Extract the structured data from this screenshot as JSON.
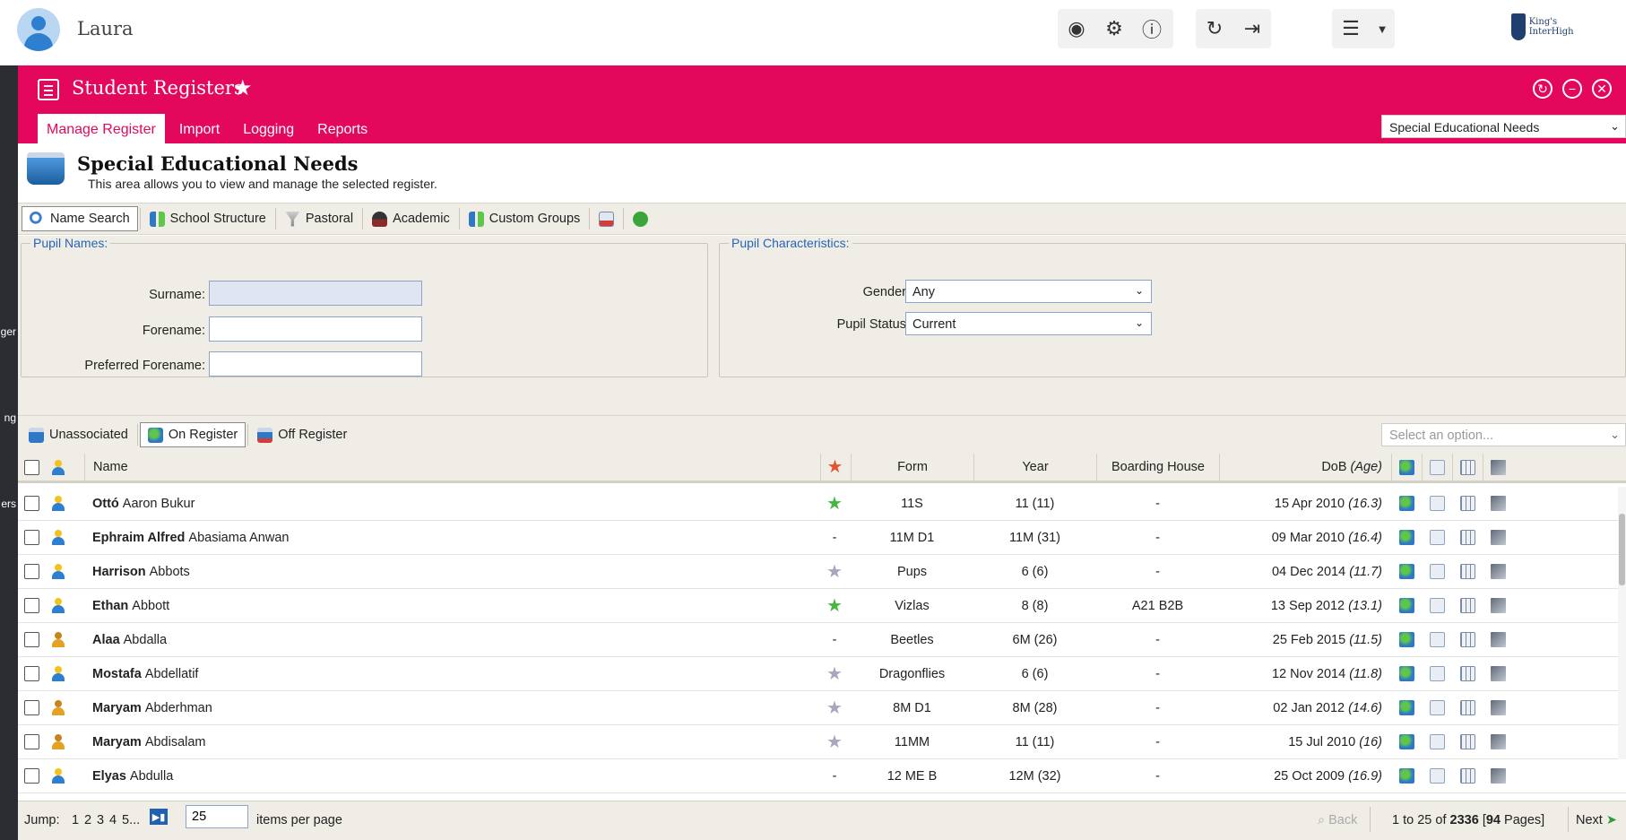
{
  "topbar": {
    "user_name": "Laura",
    "logo_text": "King's InterHigh"
  },
  "sidebar_fragments": [
    "ger",
    "ng",
    "ers"
  ],
  "module": {
    "title": "Student Registers",
    "tabs": [
      "Manage Register",
      "Import",
      "Logging",
      "Reports"
    ],
    "register_select": "Special Educational Needs"
  },
  "page": {
    "title": "Special Educational Needs",
    "description": "This area allows you to view and manage the selected register."
  },
  "toolbar": [
    "Name Search",
    "School Structure",
    "Pastoral",
    "Academic",
    "Custom Groups"
  ],
  "pupil_names": {
    "legend": "Pupil Names:",
    "surname_label": "Surname:",
    "forename_label": "Forename:",
    "preferred_label": "Preferred Forename:",
    "surname_value": "",
    "forename_value": "",
    "preferred_value": ""
  },
  "pupil_characteristics": {
    "legend": "Pupil Characteristics:",
    "gender_label": "Gender:",
    "gender_value": "Any",
    "status_label": "Pupil Status:",
    "status_value": "Current"
  },
  "register_filter": {
    "buttons": [
      "Unassociated",
      "On Register",
      "Off Register"
    ],
    "active": "On Register",
    "option_placeholder": "Select an option..."
  },
  "grid": {
    "columns": {
      "name": "Name",
      "form": "Form",
      "year": "Year",
      "boarding": "Boarding House",
      "dob": "DoB",
      "age": "(Age)"
    },
    "rows": [
      {
        "first": "Ottó",
        "last": "Aaron Bukur",
        "gender": "m",
        "star": "green",
        "form": "11S",
        "year": "11 (11)",
        "boarding": "-",
        "dob": "15 Apr 2010",
        "age": "(16.3)"
      },
      {
        "first": "Ephraim Alfred",
        "last": "Abasiama Anwan",
        "gender": "m",
        "star": "-",
        "form": "11M D1",
        "year": "11M (31)",
        "boarding": "-",
        "dob": "09 Mar 2010",
        "age": "(16.4)"
      },
      {
        "first": "Harrison",
        "last": "Abbots",
        "gender": "m",
        "star": "grey",
        "form": "Pups",
        "year": "6 (6)",
        "boarding": "-",
        "dob": "04 Dec 2014",
        "age": "(11.7)"
      },
      {
        "first": "Ethan",
        "last": "Abbott",
        "gender": "m",
        "star": "green",
        "form": "Vizlas",
        "year": "8 (8)",
        "boarding": "A21 B2B",
        "dob": "13 Sep 2012",
        "age": "(13.1)"
      },
      {
        "first": "Alaa",
        "last": "Abdalla",
        "gender": "f",
        "star": "-",
        "form": "Beetles",
        "year": "6M (26)",
        "boarding": "-",
        "dob": "25 Feb 2015",
        "age": "(11.5)"
      },
      {
        "first": "Mostafa",
        "last": "Abdellatif",
        "gender": "m",
        "star": "grey",
        "form": "Dragonflies",
        "year": "6 (6)",
        "boarding": "-",
        "dob": "12 Nov 2014",
        "age": "(11.8)"
      },
      {
        "first": "Maryam",
        "last": "Abderhman",
        "gender": "f",
        "star": "grey",
        "form": "8M D1",
        "year": "8M (28)",
        "boarding": "-",
        "dob": "02 Jan 2012",
        "age": "(14.6)"
      },
      {
        "first": "Maryam",
        "last": "Abdisalam",
        "gender": "f",
        "star": "grey",
        "form": "11MM",
        "year": "11 (11)",
        "boarding": "-",
        "dob": "15 Jul 2010",
        "age": "(16)"
      },
      {
        "first": "Elyas",
        "last": "Abdulla",
        "gender": "m",
        "star": "-",
        "form": "12 ME B",
        "year": "12M (32)",
        "boarding": "-",
        "dob": "25 Oct 2009",
        "age": "(16.9)"
      }
    ]
  },
  "pager": {
    "jump_label": "Jump:",
    "pages": [
      "1",
      "2",
      "3",
      "4",
      "5..."
    ],
    "items_per_page": "25",
    "items_per_page_label": "items per page",
    "back_label": "Back",
    "range_from": "1",
    "range_to": "25",
    "total": "2336",
    "pages_count": "94",
    "next_label": "Next"
  },
  "colors": {
    "accent": "#e4085d",
    "panel_bg": "#efede6",
    "link_blue": "#2665b7"
  }
}
